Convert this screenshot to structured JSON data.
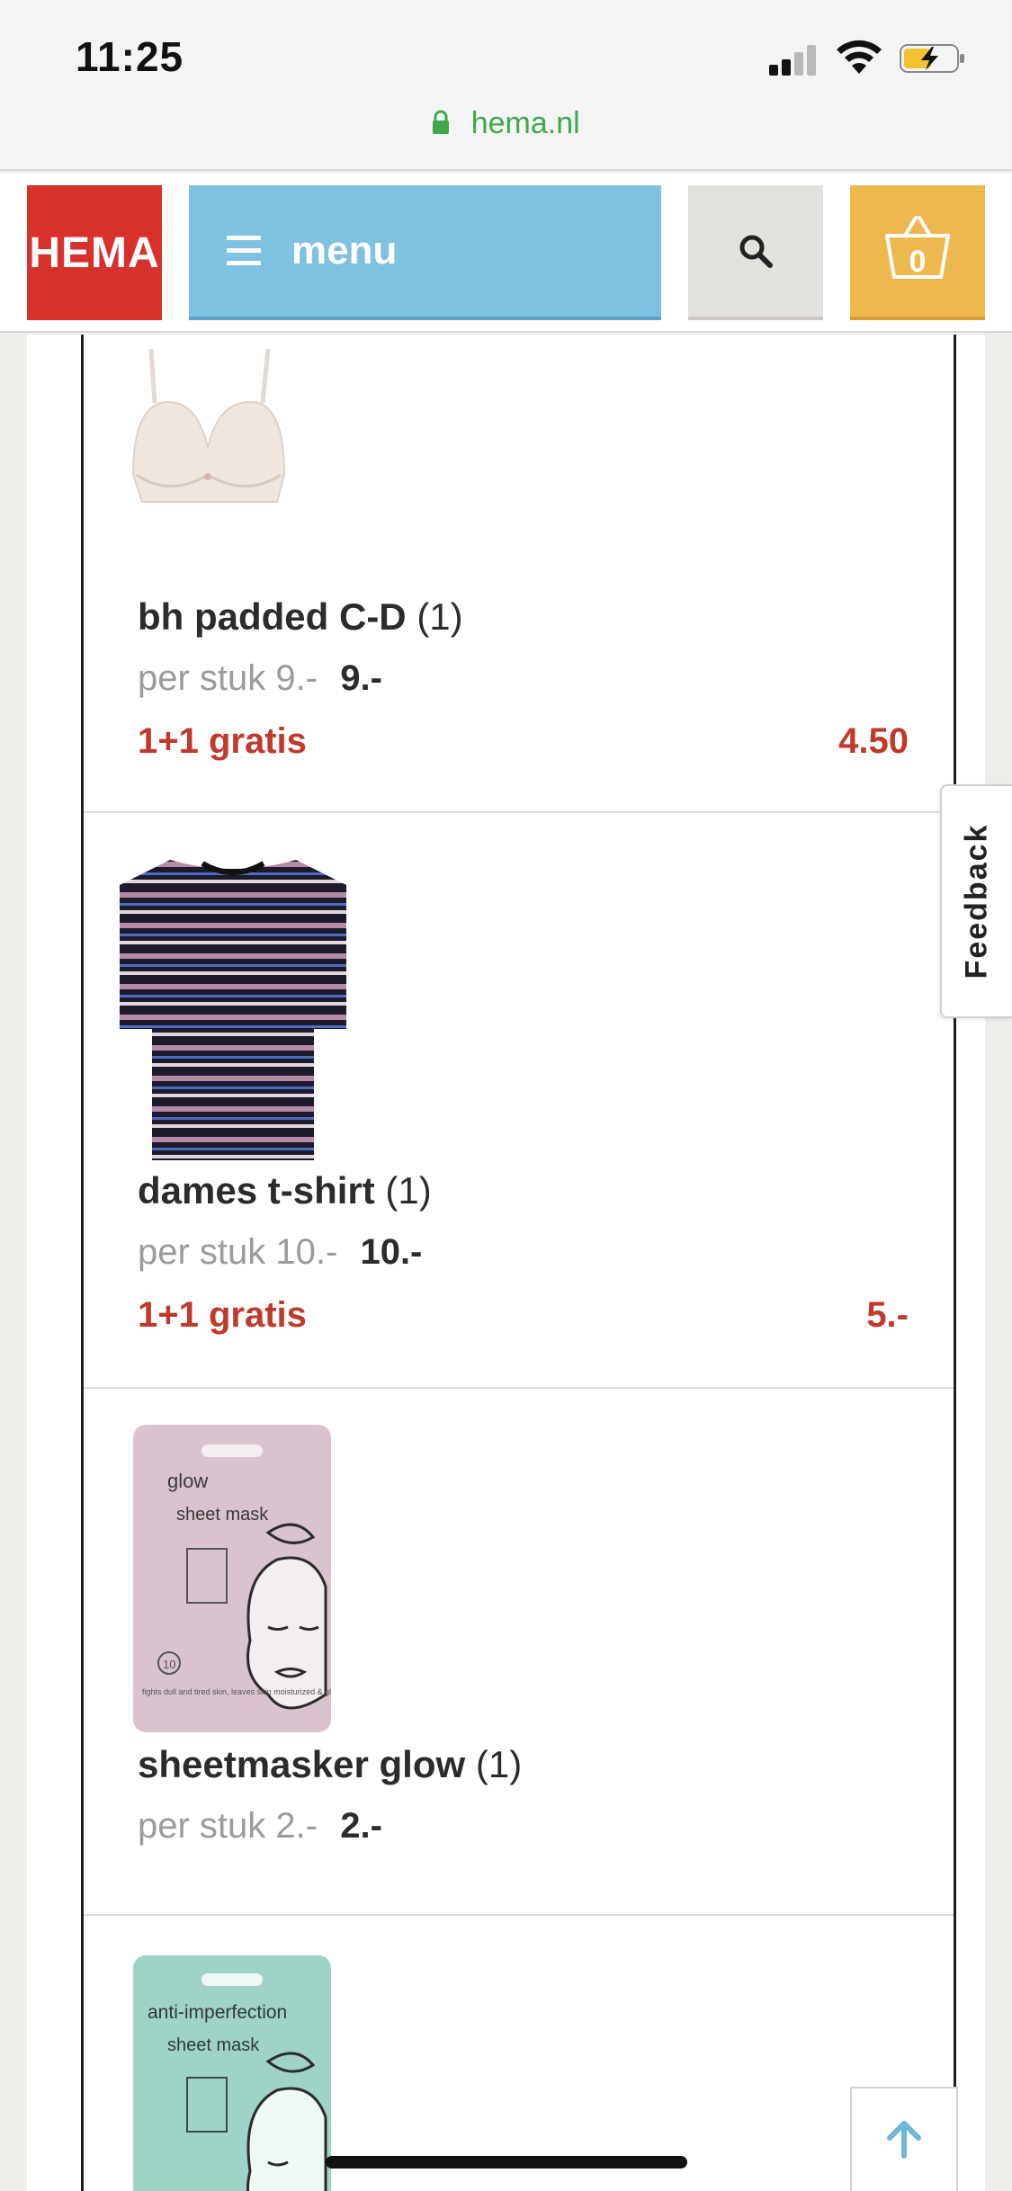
{
  "status_bar": {
    "time": "11:25"
  },
  "browser": {
    "url": "hema.nl"
  },
  "header": {
    "logo_text": "HEMA",
    "menu_label": "menu",
    "cart_count": "0"
  },
  "products": [
    {
      "name": "bh padded C-D",
      "qty": "(1)",
      "unit_price_text": "per stuk 9.-",
      "total": "9.-",
      "promo": "1+1 gratis",
      "promo_price": "4.50",
      "image": "bra-product-image"
    },
    {
      "name": "dames t-shirt",
      "qty": "(1)",
      "unit_price_text": "per stuk 10.-",
      "total": "10.-",
      "promo": "1+1 gratis",
      "promo_price": "5.-",
      "image": "striped-tshirt-product-image"
    },
    {
      "name": "sheetmasker glow",
      "qty": "(1)",
      "unit_price_text": "per stuk 2.-",
      "total": "2.-",
      "image": "sheet-mask-glow-product-image",
      "package_lines": [
        "glow",
        "sheet mask",
        "10",
        "fights dull and tired skin, leaves skin moisturized & glowing"
      ]
    },
    {
      "image": "sheet-mask-anti-imperfection-product-image",
      "package_lines": [
        "anti-imperfection",
        "sheet mask"
      ]
    }
  ],
  "feedback_label": "Feedback",
  "colors": {
    "brand_red": "#d8302b",
    "menu_blue": "#7ec1e0",
    "cart_yellow": "#edb94f",
    "promo_red": "#c0392b",
    "url_green": "#3fa84b"
  }
}
